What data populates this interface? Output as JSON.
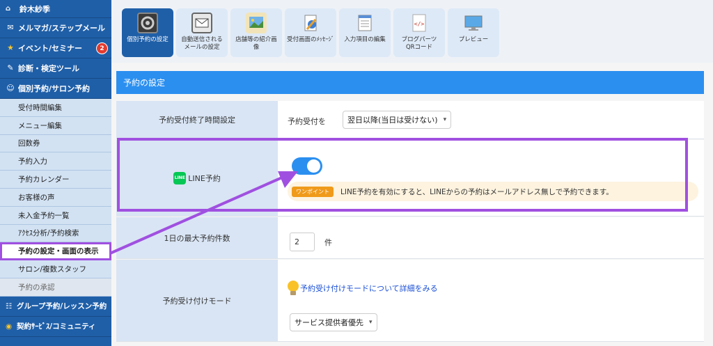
{
  "sidebar": {
    "user_name": "鈴木紗季",
    "main_items": [
      {
        "label": "メルマガ/ステップメール"
      },
      {
        "label": "イベント/セミナー",
        "badge": "2"
      },
      {
        "label": "診断・検定ツール"
      },
      {
        "label": "個別予約/サロン予約"
      }
    ],
    "sub_items": [
      {
        "label": "受付時間編集"
      },
      {
        "label": "メニュー編集"
      },
      {
        "label": "回数券"
      },
      {
        "label": "予約入力"
      },
      {
        "label": "予約カレンダー"
      },
      {
        "label": "お客様の声"
      },
      {
        "label": "未入金予約一覧"
      },
      {
        "label": "ｱｸｾｽ分析/予約検索"
      },
      {
        "label": "予約の設定・画面の表示"
      },
      {
        "label": "サロン/複数スタッフ"
      },
      {
        "label": "予約の承認"
      }
    ],
    "bottom_items": [
      {
        "label": "グループ予約/レッスン予約"
      },
      {
        "label": "契約ｻｰﾋﾞｽ/コミュニティ"
      }
    ]
  },
  "toolbar": {
    "buttons": [
      {
        "label": "個別予約の設定",
        "icon": "gear-safe-icon"
      },
      {
        "label": "自動送信される\nメールの設定",
        "icon": "mail-robot-icon"
      },
      {
        "label": "店舗等の紹介画\n像",
        "icon": "palette-image-icon"
      },
      {
        "label": "受付画面のﾒｯｾｰｼﾞ",
        "icon": "document-pen-icon"
      },
      {
        "label": "入力項目の編集",
        "icon": "notepad-icon"
      },
      {
        "label": "ブログパーツ\nQRコード",
        "icon": "code-file-icon"
      },
      {
        "label": "プレビュー",
        "icon": "monitor-icon"
      }
    ]
  },
  "section": {
    "title": "予約の設定"
  },
  "settings": {
    "deadline": {
      "label": "予約受付終了時間設定",
      "prefix": "予約受付を",
      "selected": "翌日以降(当日は受けない)"
    },
    "line": {
      "label": "LINE予約",
      "icon_text": "LINE",
      "toggle_on": true,
      "hint_badge": "ワンポイント",
      "hint_text": "LINE予約を有効にすると、LINEからの予約はメールアドレス無しで予約できます。"
    },
    "max_per_day": {
      "label": "1日の最大予約件数",
      "value": "2",
      "unit": "件"
    },
    "mode": {
      "label": "予約受け付けモード",
      "link_text": "予約受け付けモードについて詳細をみる",
      "selected": "サービス提供者優先"
    }
  },
  "colors": {
    "sidebar_bg": "#1f5fa8",
    "accent": "#2b8ff0",
    "highlight": "#a050e0",
    "badge": "#e33b2f",
    "line_green": "#06c755",
    "hint_orange": "#f09a1a"
  }
}
